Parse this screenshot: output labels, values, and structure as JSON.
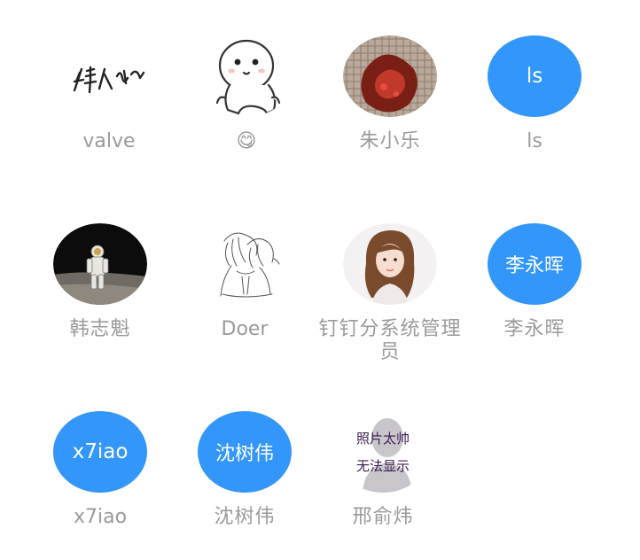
{
  "members": [
    {
      "name": "valve",
      "avatar_type": "signature-image"
    },
    {
      "name": "😋",
      "avatar_type": "cartoon-image"
    },
    {
      "name": "朱小乐",
      "avatar_type": "photo"
    },
    {
      "name": "ls",
      "avatar_type": "text",
      "avatar_text": "ls"
    },
    {
      "name": "韩志魁",
      "avatar_type": "photo"
    },
    {
      "name": "Doer",
      "avatar_type": "sketch-image"
    },
    {
      "name": "钉钉分系统管理员",
      "avatar_type": "photo"
    },
    {
      "name": "李永晖",
      "avatar_type": "text",
      "avatar_text": "李永晖"
    },
    {
      "name": "x7iao",
      "avatar_type": "text",
      "avatar_text": "x7iao"
    },
    {
      "name": "沈树伟",
      "avatar_type": "text",
      "avatar_text": "沈树伟"
    },
    {
      "name": "邢俞炜",
      "avatar_type": "placeholder",
      "placeholder_lines": [
        "照片太帅",
        "无法显示"
      ]
    }
  ],
  "colors": {
    "avatar_blue": "#3296fa",
    "name_gray": "#9a9a9a",
    "placeholder_text": "#3a1b52"
  }
}
